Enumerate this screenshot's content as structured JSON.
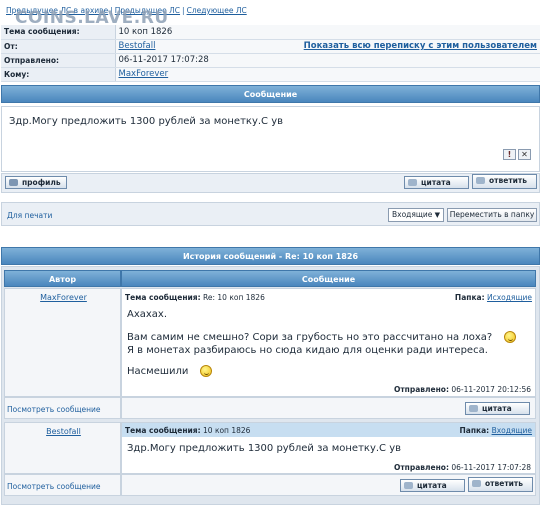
{
  "watermark": "COINS.LAVE.RU",
  "topnav": {
    "prev_archive": "Предыдущее ЛС в архиве",
    "prev": "Предыдущее ЛС",
    "next": "Следующее ЛС"
  },
  "header": {
    "subject_label": "Тема сообщения:",
    "subject": "10 коп 1826",
    "from_label": "От:",
    "from": "Bestofall",
    "show_all": "Показать всю переписку с этим пользователем",
    "sent_label": "Отправлено:",
    "sent": "06-11-2017 17:07:28",
    "to_label": "Кому:",
    "to": "MaxForever"
  },
  "message": {
    "title": "Сообщение",
    "text": "Здр.Могу предложить 1300 рублей за монетку.С ув"
  },
  "buttons": {
    "profile": "профиль",
    "quote": "цитата",
    "reply": "ответить"
  },
  "actions": {
    "print": "Для печати",
    "folder": "Входящие",
    "move": "Переместить в папку"
  },
  "history": {
    "title": "История сообщений - Re: 10 коп 1826",
    "col_author": "Автор",
    "col_message": "Сообщение",
    "subject_label": "Тема сообщения:",
    "folder_label": "Папка:",
    "sent_label": "Отправлено:",
    "view_message": "Посмотреть сообщение",
    "items": [
      {
        "author": "MaxForever",
        "subject": "Re: 10 коп 1826",
        "folder": "Исходящие",
        "lines": [
          "Ахахах.",
          "Вам самим не смешно? Сори за грубость но это рассчитано на лоха?",
          "Я в монетах разбираюсь но сюда кидаю для оценки ради интереса.",
          "Насмешили"
        ],
        "sent": "06-11-2017 20:12:56"
      },
      {
        "author": "Bestofall",
        "subject": "10 коп 1826",
        "folder": "Входящие",
        "lines": [
          "Здр.Могу предложить 1300 рублей за монетку.С ув"
        ],
        "sent": "06-11-2017 17:07:28"
      }
    ]
  }
}
